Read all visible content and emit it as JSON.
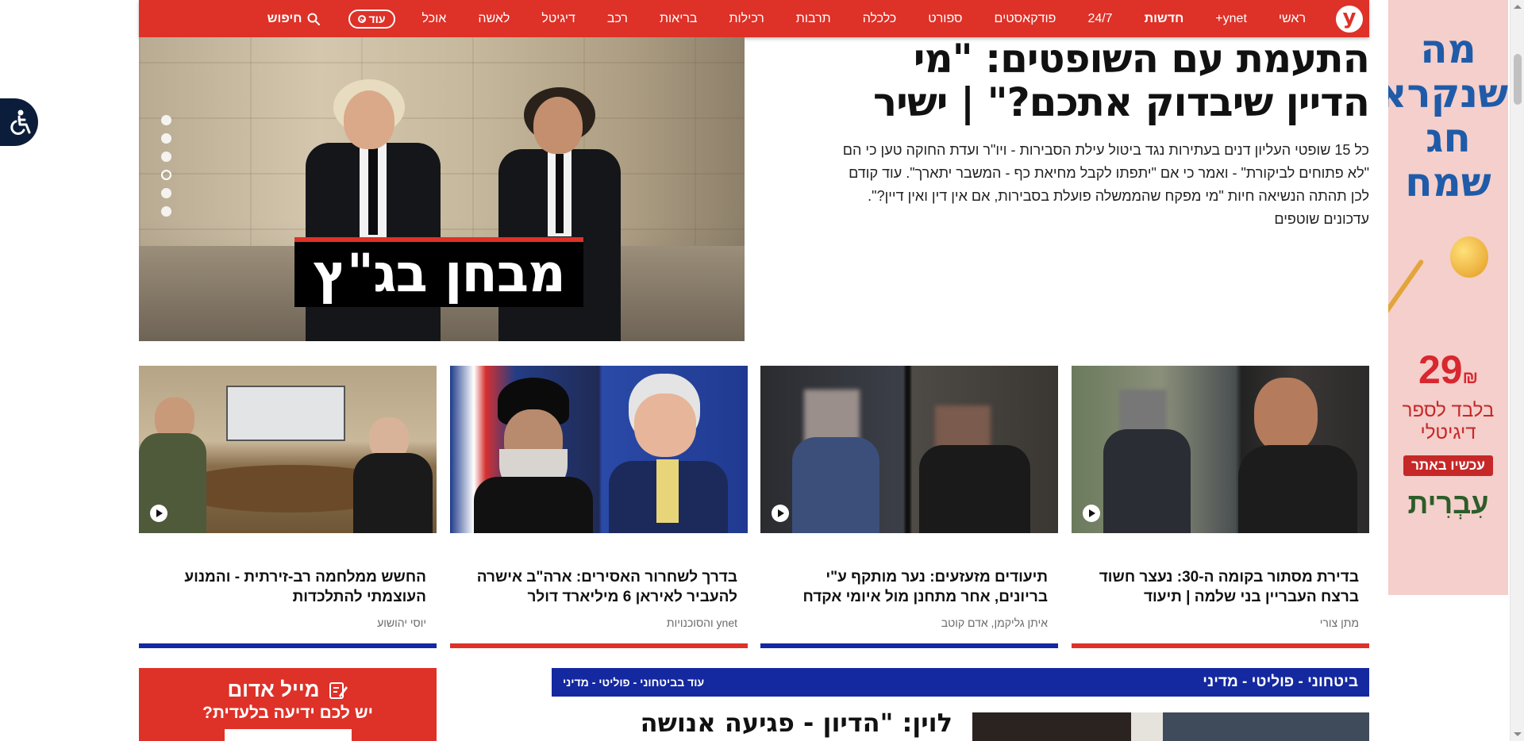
{
  "nav": {
    "logo_letter": "y",
    "items": [
      {
        "label": "ראשי",
        "bold": false
      },
      {
        "label": "ynet+",
        "bold": false
      },
      {
        "label": "חדשות",
        "bold": true
      },
      {
        "label": "24/7",
        "bold": false
      },
      {
        "label": "פודקאסטים",
        "bold": false
      },
      {
        "label": "ספורט",
        "bold": false
      },
      {
        "label": "כלכלה",
        "bold": false
      },
      {
        "label": "תרבות",
        "bold": false
      },
      {
        "label": "רכילות",
        "bold": false
      },
      {
        "label": "בריאות",
        "bold": false
      },
      {
        "label": "רכב",
        "bold": false
      },
      {
        "label": "דיגיטל",
        "bold": false
      },
      {
        "label": "לאשה",
        "bold": false
      },
      {
        "label": "אוכל",
        "bold": false
      }
    ],
    "more_label": "עוד",
    "search_label": "חיפוש"
  },
  "hero": {
    "title": "התעמת עם השופטים: \"מי הדיין שיבדוק אתכם?\" | ישיר",
    "summary": "כל 15 שופטי העליון דנים בעתירות נגד ביטול עילת הסבירות - ויו\"ר ועדת החוקה טען כי הם \"לא פתוחים לביקורת\" - ואמר כי אם \"יתפתו לקבל מחיאת כף - המשבר יתארך\". עוד קודם לכן תהתה הנשיאה חיות \"מי מפקח שהממשלה פועלת בסבירות, אם אין דין ואין דיין?\". עדכונים שוטפים",
    "badge": "מבחן בג\"ץ",
    "active_dot": 3,
    "dots": 6
  },
  "cards": [
    {
      "headline": "בדירת מסתור בקומה ה-30: נעצר חשוד ברצח העבריין בני שלמה | תיעוד",
      "author": "מתן צורי",
      "has_video": true,
      "bar_color": "#de3128"
    },
    {
      "headline": "תיעודים מזעזעים: נער מותקף ע\"י בריונים, אחר מתחנן מול איומי אקדח",
      "author": "איתן גליקמן, אדם קוטב",
      "has_video": true,
      "bar_color": "#1428a0"
    },
    {
      "headline": "בדרך לשחרור האסירים: ארה\"ב אישרה להעביר לאיראן 6 מיליארד דולר",
      "author": "ynet והסוכנויות",
      "has_video": false,
      "bar_color": "#de3128"
    },
    {
      "headline": "החשש ממלחמה רב-זירתית - והמנוע העוצמתי להתלכדות",
      "author": "יוסי יהושוע",
      "has_video": true,
      "bar_color": "#1428a0"
    }
  ],
  "mail_box": {
    "title": "מייל אדום",
    "subtitle": "יש לכם ידיעה בלעדית?"
  },
  "section": {
    "title": "ביטחוני - פוליטי - מדיני",
    "more": "עוד בביטחוני - פוליטי - מדיני",
    "headline": "לוין: \"הדיון - פגיעה אנושה"
  },
  "side_ad": {
    "headline": "מה שנקרא חג שמח",
    "price": "29",
    "currency": "₪",
    "sub": "בלבד לספר דיגיטלי",
    "cta": "עכשיו באתר",
    "brand": "עִבְרִית"
  },
  "colors": {
    "brand_red": "#de3128",
    "section_blue": "#1428a0"
  }
}
